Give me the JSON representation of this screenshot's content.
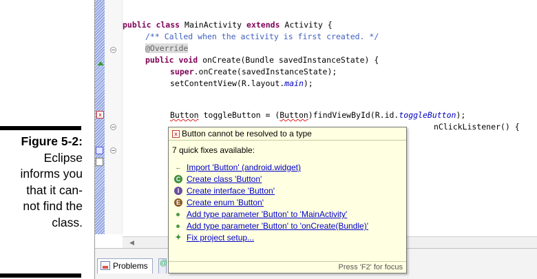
{
  "caption": {
    "label": "Figure 5-2:",
    "lines": [
      "Eclipse",
      "informs you",
      "that it can-",
      "not find the",
      "class."
    ]
  },
  "editor": {
    "code_lines": {
      "class_decl_kw": "public class",
      "class_decl_rest": " MainActivity ",
      "class_decl_kw2": "extends",
      "class_decl_tail": " Activity {",
      "comment": "/** Called when the activity is first created. */",
      "override": "@Override",
      "method_kw": "public void",
      "method_rest": " onCreate(Bundle savedInstanceState) {",
      "super_kw": "super",
      "super_rest": ".onCreate(savedInstanceState);",
      "setcontent_pre": "setContentView(R.layout.",
      "setcontent_it": "main",
      "setcontent_post": ");",
      "button_err": "Button",
      "button_mid": " toggleButton = (",
      "button_err2": "Button",
      "button_find": ")findViewById(R.id.",
      "button_it": "toggleButton",
      "button_end": ");",
      "listener_tail": "nClickListener() {"
    }
  },
  "quickfix": {
    "title": "Button cannot be resolved to a type",
    "count": "7 quick fixes available:",
    "fixes": [
      {
        "label": "Import 'Button' (android.widget)",
        "icon": "import-icon"
      },
      {
        "label": "Create class 'Button'",
        "icon": "class-icon"
      },
      {
        "label": "Create interface 'Button'",
        "icon": "interface-icon"
      },
      {
        "label": "Create enum 'Button'",
        "icon": "enum-icon"
      },
      {
        "label": "Add type parameter 'Button' to 'MainActivity'",
        "icon": "type-parameter-icon"
      },
      {
        "label": "Add type parameter 'Button' to 'onCreate(Bundle)'",
        "icon": "type-parameter-icon"
      },
      {
        "label": "Fix project setup...",
        "icon": "setup-icon"
      }
    ],
    "footer": "Press 'F2' for focus"
  },
  "bottom_panel": {
    "problems_tab": "Problems"
  },
  "colors": {
    "keyword": "#7f0055",
    "comment": "#3f5fbf",
    "link": "#0000cc",
    "popup_bg": "#ffffe1"
  }
}
